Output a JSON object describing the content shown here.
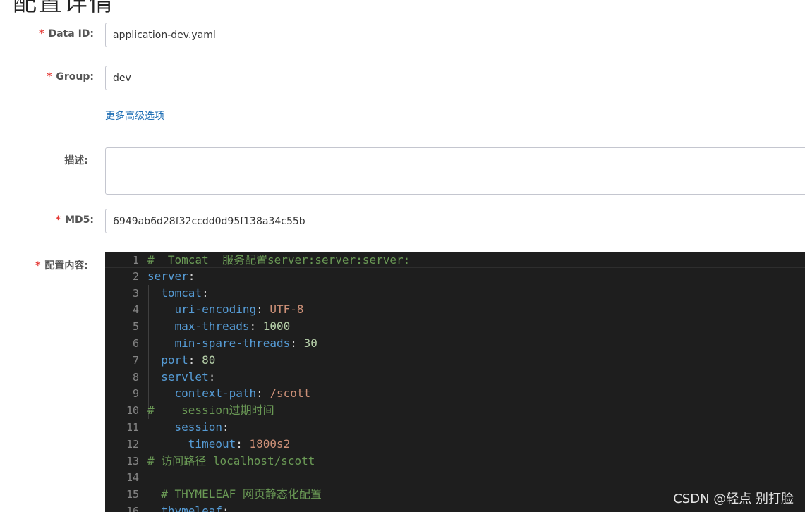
{
  "page": {
    "title": "配置详情"
  },
  "form": {
    "data_id": {
      "label": "Data ID:",
      "value": "application-dev.yaml"
    },
    "group": {
      "label": "Group:",
      "value": "dev"
    },
    "advanced_link": "更多高级选项",
    "description": {
      "label": "描述:",
      "value": ""
    },
    "md5": {
      "label": "MD5:",
      "value": "6949ab6d28f32ccdd0d95f138a34c55b"
    },
    "content": {
      "label": "配置内容:"
    },
    "required_mark": "*"
  },
  "editor": {
    "lines": [
      {
        "n": "1",
        "t": [
          [
            "c",
            "#  Tomcat  服务配置server:server:server:"
          ]
        ]
      },
      {
        "n": "2",
        "t": [
          [
            "k",
            "server"
          ],
          [
            "p",
            ":"
          ]
        ]
      },
      {
        "n": "3",
        "t": [
          [
            "p",
            "  "
          ],
          [
            "k",
            "tomcat"
          ],
          [
            "p",
            ":"
          ]
        ]
      },
      {
        "n": "4",
        "t": [
          [
            "p",
            "    "
          ],
          [
            "k",
            "uri-encoding"
          ],
          [
            "p",
            ": "
          ],
          [
            "s",
            "UTF-8"
          ]
        ]
      },
      {
        "n": "5",
        "t": [
          [
            "p",
            "    "
          ],
          [
            "k",
            "max-threads"
          ],
          [
            "p",
            ": "
          ],
          [
            "n",
            "1000"
          ]
        ]
      },
      {
        "n": "6",
        "t": [
          [
            "p",
            "    "
          ],
          [
            "k",
            "min-spare-threads"
          ],
          [
            "p",
            ": "
          ],
          [
            "n",
            "30"
          ]
        ]
      },
      {
        "n": "7",
        "t": [
          [
            "p",
            "  "
          ],
          [
            "k",
            "port"
          ],
          [
            "p",
            ": "
          ],
          [
            "n",
            "80"
          ]
        ]
      },
      {
        "n": "8",
        "t": [
          [
            "p",
            "  "
          ],
          [
            "k",
            "servlet"
          ],
          [
            "p",
            ":"
          ]
        ]
      },
      {
        "n": "9",
        "t": [
          [
            "p",
            "    "
          ],
          [
            "k",
            "context-path"
          ],
          [
            "p",
            ": "
          ],
          [
            "s",
            "/scott"
          ]
        ]
      },
      {
        "n": "10",
        "t": [
          [
            "c",
            "#    session过期时间"
          ]
        ]
      },
      {
        "n": "11",
        "t": [
          [
            "p",
            "    "
          ],
          [
            "k",
            "session"
          ],
          [
            "p",
            ":"
          ]
        ]
      },
      {
        "n": "12",
        "t": [
          [
            "p",
            "      "
          ],
          [
            "k",
            "timeout"
          ],
          [
            "p",
            ": "
          ],
          [
            "s",
            "1800s2"
          ]
        ]
      },
      {
        "n": "13",
        "t": [
          [
            "c",
            "# 访问路径 localhost/scott"
          ]
        ]
      },
      {
        "n": "14",
        "t": []
      },
      {
        "n": "15",
        "t": [
          [
            "p",
            "  "
          ],
          [
            "c",
            "# THYMELEAF 网页静态化配置"
          ]
        ]
      },
      {
        "n": "16",
        "t": [
          [
            "p",
            "  "
          ],
          [
            "k",
            "thymeleaf"
          ],
          [
            "p",
            ":"
          ]
        ]
      }
    ]
  },
  "watermark": "CSDN @轻点 别打脸"
}
